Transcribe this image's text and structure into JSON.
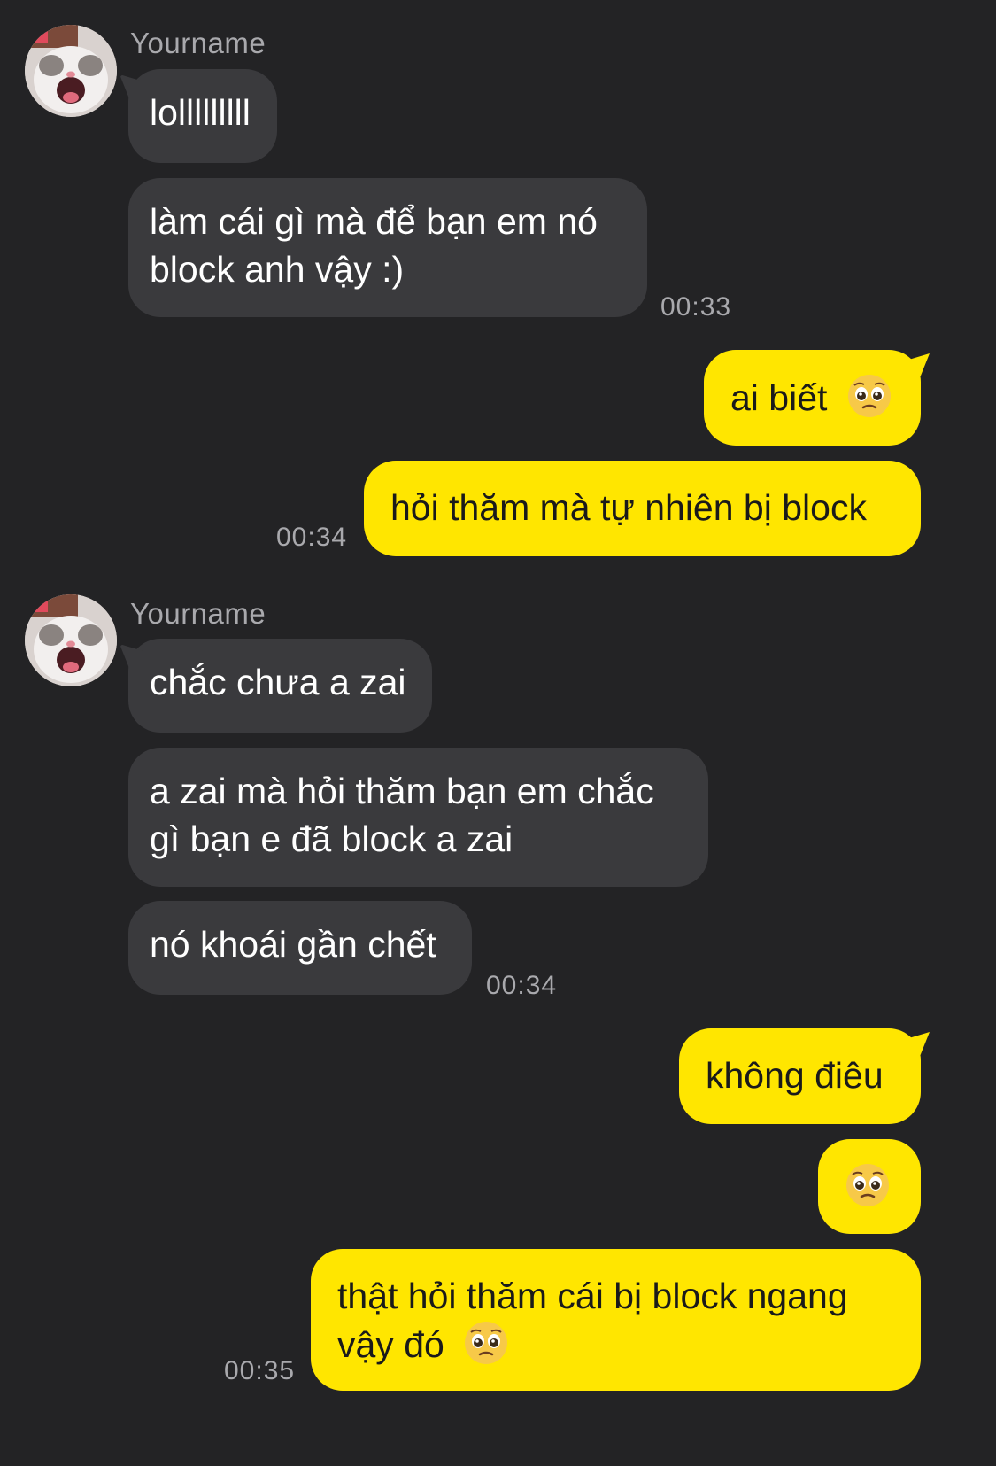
{
  "chat": {
    "groups": [
      {
        "sender": "Yourname",
        "messages": [
          "lolllllllll",
          "làm cái gì mà để bạn em nó block anh vậy :)"
        ],
        "time": "00:33"
      },
      {
        "outgoing": true,
        "messages": [
          "ai biết",
          "hỏi thăm mà tự nhiên bị block"
        ],
        "time": "00:34"
      },
      {
        "sender": "Yourname",
        "messages": [
          "chắc chưa a zai",
          "a zai mà hỏi thăm bạn em chắc gì bạn e đã block a zai",
          "nó khoái gần chết"
        ],
        "time": "00:34"
      },
      {
        "outgoing": true,
        "messages": [
          "không điêu",
          "",
          "thật hỏi thăm cái bị block ngang vậy đó"
        ],
        "time": "00:35"
      }
    ]
  },
  "colors": {
    "background": "#232325",
    "incoming_bubble": "#3a3a3d",
    "outgoing_bubble": "#ffe600",
    "secondary_text": "#a9a9ad"
  },
  "icons": {
    "avatar": "cat-avatar",
    "emoji": "pleading-face-emoji"
  }
}
